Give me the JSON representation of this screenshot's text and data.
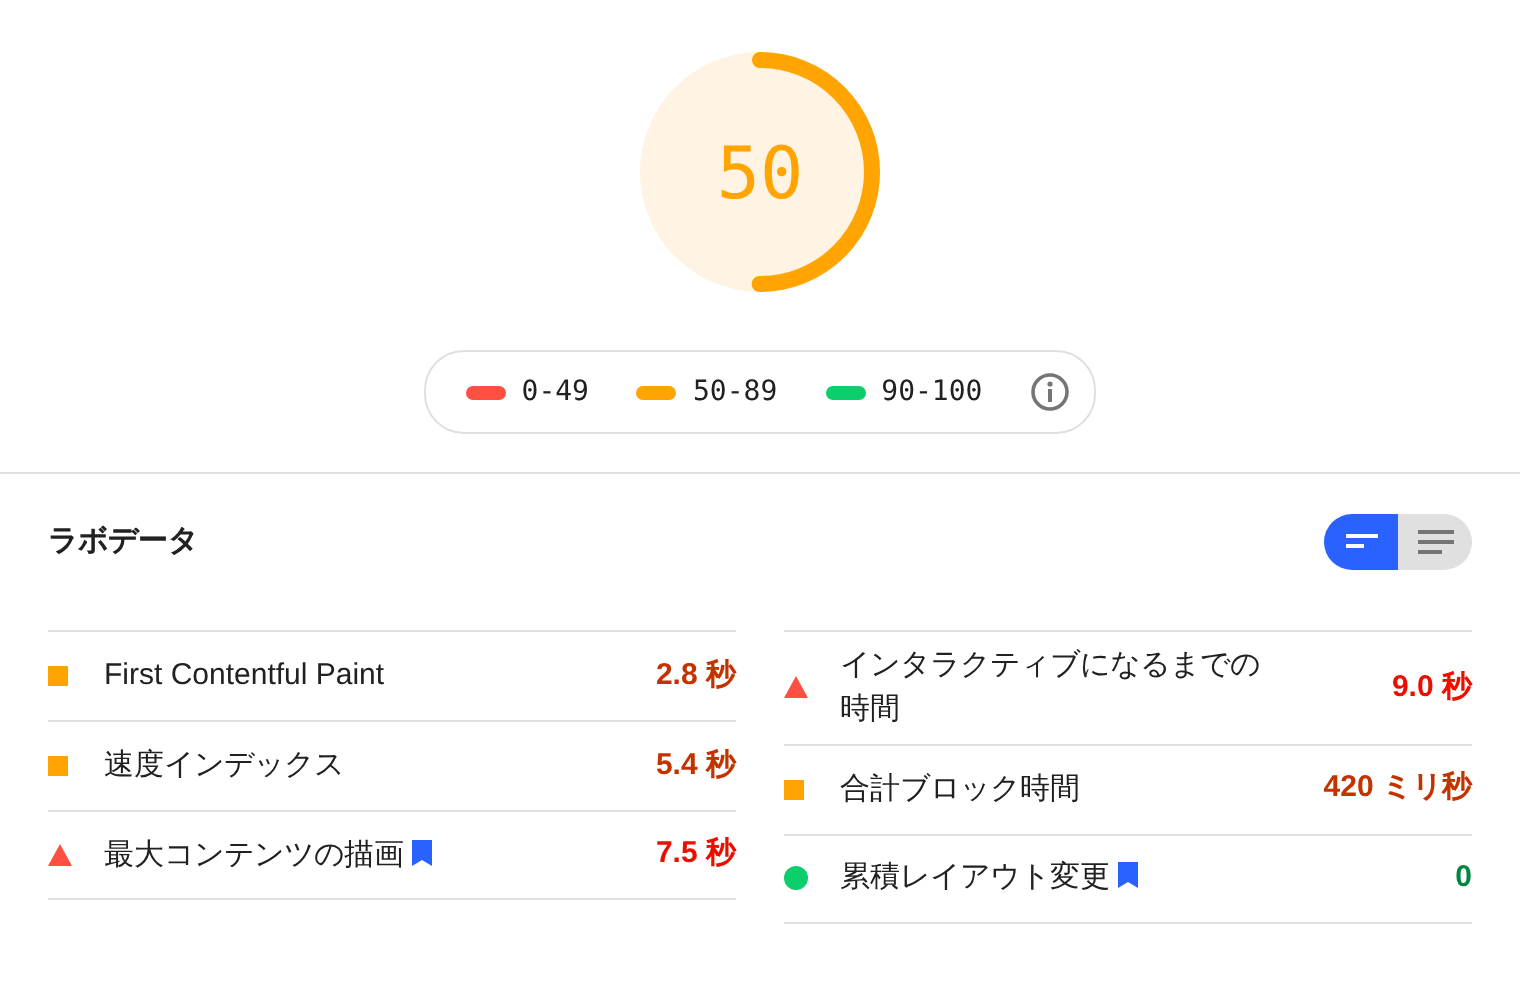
{
  "gauge": {
    "score": "50",
    "kind": "average"
  },
  "legend": [
    {
      "range": "0-49",
      "kind": "fail"
    },
    {
      "range": "50-89",
      "kind": "average"
    },
    {
      "range": "90-100",
      "kind": "pass"
    }
  ],
  "lab_data": {
    "title": "ラボデータ",
    "view_toggle": [
      {
        "kind": "compact",
        "selected": true
      },
      {
        "kind": "expanded",
        "selected": false
      }
    ],
    "metrics": [
      {
        "label": "First Contentful Paint",
        "value": "2.8 秒",
        "kind": "average",
        "bookmark": false
      },
      {
        "label": "インタラクティブになるまでの時間",
        "value": "9.0 秒",
        "kind": "fail",
        "bookmark": false
      },
      {
        "label": "速度インデックス",
        "value": "5.4 秒",
        "kind": "average",
        "bookmark": false
      },
      {
        "label": "合計ブロック時間",
        "value": "420 ミリ秒",
        "kind": "average",
        "bookmark": false
      },
      {
        "label": "最大コンテンツの描画",
        "value": "7.5 秒",
        "kind": "fail",
        "bookmark": true
      },
      {
        "label": "累積レイアウト変更",
        "value": "0",
        "kind": "pass",
        "bookmark": true
      }
    ]
  }
}
